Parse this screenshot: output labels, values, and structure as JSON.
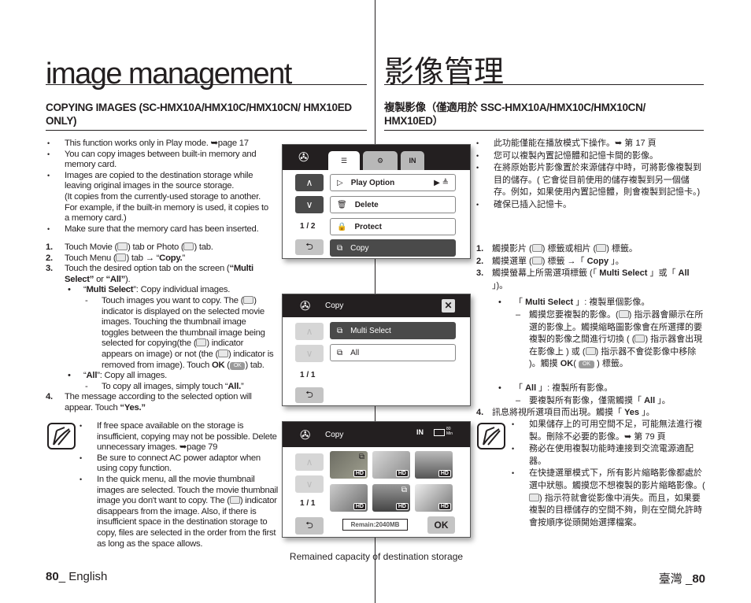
{
  "left": {
    "title": "image management",
    "heading": "COPYING IMAGES (SC-HMX10A/HMX10C/HMX10CN/ HMX10ED ONLY)",
    "bullets": [
      "This function works only in Play mode. ➥page 17",
      "You can copy images between built-in memory and memory card.",
      "Images are copied to the destination storage while leaving original images in the source storage.",
      "Make sure that the memory card has been inserted."
    ],
    "bullet3_extra": "(It copies from the currently-used storage to another. For example, if the built-in memory is used, it copies to a memory card.)",
    "steps": {
      "s1": {
        "num": "1.",
        "a": "Touch Movie (",
        "b": ") tab or Photo (",
        "c": ") tab."
      },
      "s2": {
        "num": "2.",
        "a": "Touch Menu (",
        "b": ") tab → “",
        "c": "Copy.",
        "d": "”"
      },
      "s3": {
        "num": "3.",
        "a": "Touch the desired option tab on the screen (",
        "b": "“Multi Select”",
        "c": " or ",
        "d": "“All”",
        "e": ")."
      },
      "ms": {
        "a": "“",
        "b": "Multi Select",
        "c": "”: Copy individual images."
      },
      "msd": {
        "a": "Touch images you want to copy. The (",
        "b": ") indicator is displayed on the selected movie images. Touching the thumbnail image toggles between the thumbnail image being selected for copying(the (",
        "c": ") indicator appears on image) or not (the (",
        "d": ") indicator is removed from image). Touch ",
        "e": "OK",
        "f": " (",
        "g": ") tab."
      },
      "ok_badge": "OK",
      "all": {
        "a": "“",
        "b": "All",
        "c": "”: Copy all images."
      },
      "alld": {
        "a": "To copy all images, simply touch “",
        "b": "All.",
        "c": "”"
      },
      "s4": {
        "num": "4.",
        "a": "The message according to the selected option will appear. Touch ",
        "b": "“Yes.”"
      }
    },
    "notes": [
      "If free space available on the storage is insufficient, copying may not be possible. Delete unnecessary images. ➥page 79",
      "Be sure to connect AC power adaptor when using copy function.",
      "In the quick menu, all the movie thumbnail images are selected. Touch the movie thumbnail image you don't want to copy. The (",
      ") indicator disappears from the image. Also, if there is insufficient space in the destination storage to copy, files are selected in the order from the first as long as the space allows."
    ],
    "footer": {
      "page": "80",
      "label": "_ English"
    }
  },
  "right": {
    "title": "影像管理",
    "heading": "複製影像（僅適用於 SSC-HMX10A/HMX10C/HMX10CN/ HMX10ED）",
    "bullets": [
      "此功能僅能在播放模式下操作。➥ 第 17 頁",
      "您可以複製內置記憶體和記憶卡間的影像。",
      "在將原始影片影像置於來源儲存中時，可將影像複製到目的儲存。( 它會從目前使用的儲存複製到另一個儲存。例如，如果使用內置記憶體，則會複製到記憶卡。)",
      "確保已插入記憶卡。"
    ],
    "steps": {
      "s1": {
        "num": "1.",
        "a": "觸摸影片 (",
        "b": ") 標籤或相片 (",
        "c": ") 標籤。"
      },
      "s2": {
        "num": "2.",
        "a": "觸摸選單 (",
        "b": ") 標籤 →「 ",
        "c": "Copy",
        "d": " 」。"
      },
      "s3": {
        "num": "3.",
        "a": "觸摸螢幕上所需選項標籤 (「 ",
        "b": "Multi Select",
        "c": " 」或「 ",
        "d": "All",
        "e": " 」)。"
      },
      "ms": {
        "a": "「 ",
        "b": "Multi Select",
        "c": " 」: 複製單個影像。"
      },
      "msd": {
        "a": "觸摸您要複製的影像。(",
        "b": ") 指示器會顯示在所選的影像上。觸摸縮略圖影像會在所選擇的要複製的影像之間進行切換 ( (",
        "c": ") 指示器會出現在影像上 ) 或 (",
        "d": ") 指示器不會從影像中移除 )。觸摸 ",
        "e": "OK",
        "f": "( ",
        "g": " ) 標籤。"
      },
      "all": {
        "a": "「 ",
        "b": "All",
        "c": " 」: 複製所有影像。"
      },
      "alld": {
        "a": "要複製所有影像，僅需觸摸「 ",
        "b": "All",
        "c": " 」。"
      },
      "s4": {
        "num": "4.",
        "a": "訊息將視所選項目而出現。觸摸「 ",
        "b": "Yes",
        "c": " 」。"
      }
    },
    "notes": [
      "如果儲存上的可用空間不足，可能無法進行複製。刪除不必要的影像。➥ 第 79 頁",
      "務必在使用複製功能時連接到交流電源適配器。",
      "在快捷選單模式下，所有影片縮略影像都處於選中狀態。觸摸您不想複製的影片縮略影像。(",
      ") 指示符就會從影像中消失。而且，如果要複製的目標儲存的空間不夠，則在空間允許時會按順序從頭開始選擇檔案。"
    ],
    "footer": {
      "label": "臺灣 _",
      "page": "80"
    }
  },
  "screen1": {
    "tabs": [
      "menu-tab",
      "settings-tab",
      "storage-tab"
    ],
    "storage_tab_label": "IN",
    "items": [
      "Play Option",
      "Delete",
      "Protect",
      "Copy"
    ],
    "selected": "Copy",
    "page": "1 / 2"
  },
  "screen2": {
    "title": "Copy",
    "items": [
      "Multi Select",
      "All"
    ],
    "selected": "Multi Select",
    "page": "1 / 1"
  },
  "screen3": {
    "title": "Copy",
    "storage": "IN",
    "battery": "80 Min",
    "hd_badge": "HD",
    "page": "1 / 1",
    "remain": "Remain:2040MB",
    "ok": "OK",
    "thumbnails_selected": [
      true,
      false,
      false,
      false,
      true,
      false
    ]
  },
  "caption": "Remained capacity of destination storage"
}
